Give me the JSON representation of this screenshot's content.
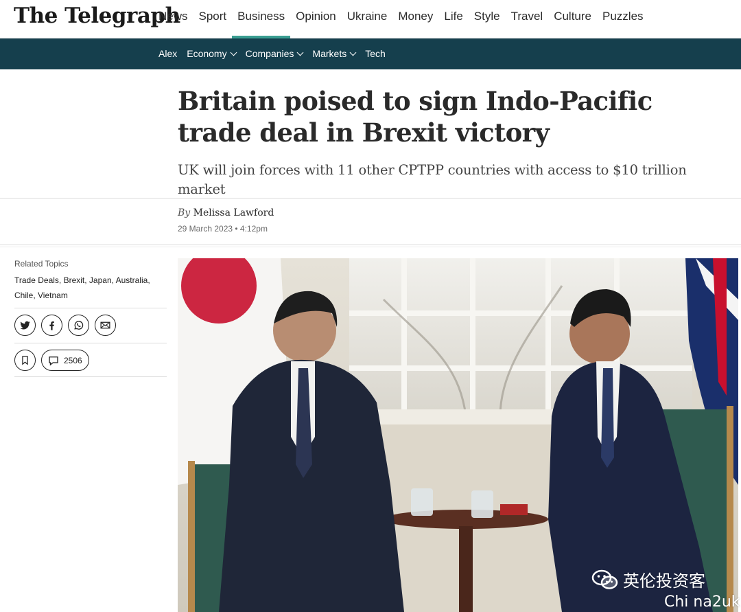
{
  "masthead": {
    "logo": "The Telegraph",
    "nav": [
      "News",
      "Sport",
      "Business",
      "Opinion",
      "Ukraine",
      "Money",
      "Life",
      "Style",
      "Travel",
      "Culture",
      "Puzzles"
    ],
    "active": "Business"
  },
  "subnav": {
    "items": [
      {
        "label": "Alex",
        "dropdown": false
      },
      {
        "label": "Economy",
        "dropdown": true
      },
      {
        "label": "Companies",
        "dropdown": true
      },
      {
        "label": "Markets",
        "dropdown": true
      },
      {
        "label": "Tech",
        "dropdown": false
      }
    ]
  },
  "article": {
    "headline": "Britain poised to sign Indo-Pacific trade deal in Brexit victory",
    "standfirst": "UK will join forces with 11 other CPTPP countries with access to $10 trillion market",
    "by_prefix": "By",
    "author": "Melissa Lawford",
    "date": "29 March 2023 • 4:12pm"
  },
  "sidebar": {
    "related_label": "Related Topics",
    "related_topics": "Trade Deals, Brexit, Japan, Australia, Chile, Vietnam",
    "comment_count": "2506"
  },
  "watermark": {
    "text": "英伦投资客",
    "handle": "Chi na2uk"
  },
  "colors": {
    "subbar": "#153f4d",
    "active_underline": "#3a9e92"
  },
  "icons": [
    "twitter-icon",
    "facebook-icon",
    "whatsapp-icon",
    "email-icon",
    "bookmark-icon",
    "comment-icon",
    "wechat-icon"
  ]
}
